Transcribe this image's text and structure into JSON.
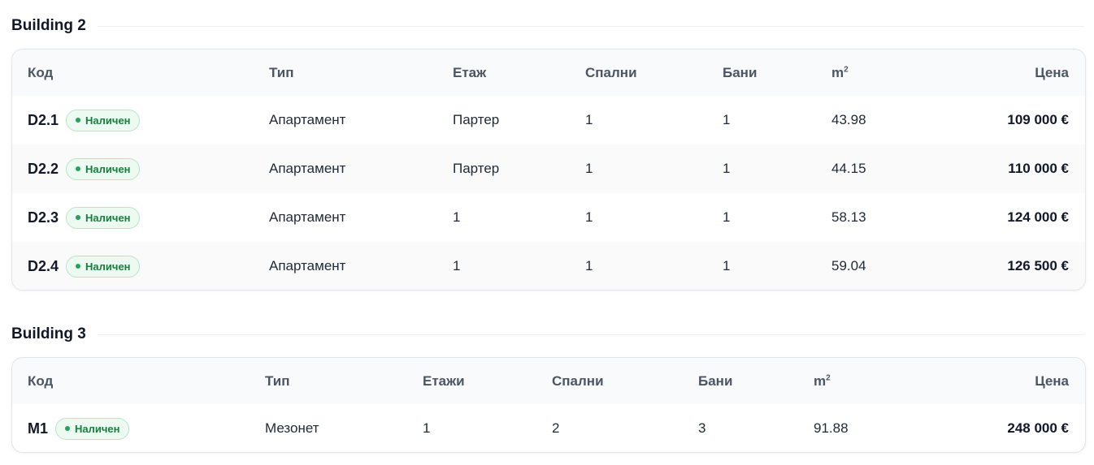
{
  "buildings": [
    {
      "title": "Building 2",
      "headers": {
        "code": "Код",
        "type": "Тип",
        "floor": "Етаж",
        "bedrooms": "Спални",
        "baths": "Бани",
        "area": "m",
        "area_sup": "2",
        "price": "Цена"
      },
      "rows": [
        {
          "code": "D2.1",
          "status": "Наличен",
          "type": "Апартамент",
          "floor": "Партер",
          "bedrooms": "1",
          "baths": "1",
          "area": "43.98",
          "price": "109 000 €"
        },
        {
          "code": "D2.2",
          "status": "Наличен",
          "type": "Апартамент",
          "floor": "Партер",
          "bedrooms": "1",
          "baths": "1",
          "area": "44.15",
          "price": "110 000 €"
        },
        {
          "code": "D2.3",
          "status": "Наличен",
          "type": "Апартамент",
          "floor": "1",
          "bedrooms": "1",
          "baths": "1",
          "area": "58.13",
          "price": "124 000 €"
        },
        {
          "code": "D2.4",
          "status": "Наличен",
          "type": "Апартамент",
          "floor": "1",
          "bedrooms": "1",
          "baths": "1",
          "area": "59.04",
          "price": "126 500 €"
        }
      ]
    },
    {
      "title": "Building 3",
      "headers": {
        "code": "Код",
        "type": "Тип",
        "floor": "Етажи",
        "bedrooms": "Спални",
        "baths": "Бани",
        "area": "m",
        "area_sup": "2",
        "price": "Цена"
      },
      "rows": [
        {
          "code": "M1",
          "status": "Наличен",
          "type": "Мезонет",
          "floor": "1",
          "bedrooms": "2",
          "baths": "3",
          "area": "91.88",
          "price": "248 000 €"
        }
      ]
    }
  ],
  "colors": {
    "badge_text": "#15803d",
    "badge_bg": "#ecfaf1",
    "badge_border": "#b7e4c7",
    "dot": "#22a35a"
  }
}
